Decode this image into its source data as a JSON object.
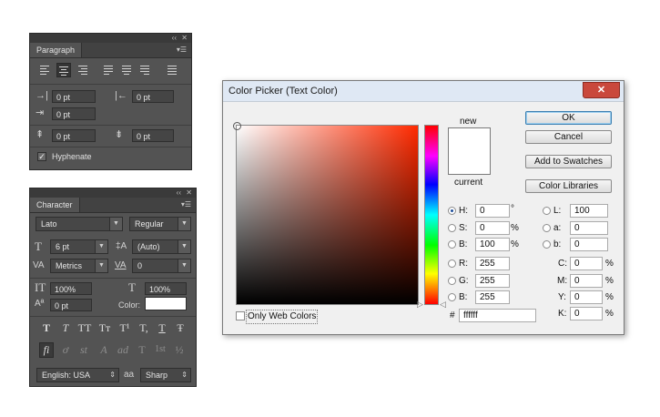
{
  "paragraph_panel": {
    "tab": "Paragraph",
    "collapse": "‹‹",
    "close": "✕",
    "menu": "▾☰",
    "indent_left": "0 pt",
    "indent_right": "0 pt",
    "indent_first_line": "0 pt",
    "space_before": "0 pt",
    "space_after": "0 pt",
    "hyphenate_label": "Hyphenate",
    "hyphenate_checked": true
  },
  "character_panel": {
    "tab": "Character",
    "collapse": "‹‹",
    "close": "✕",
    "menu": "▾☰",
    "font_family": "Lato",
    "font_style": "Regular",
    "font_size": "6 pt",
    "leading": "(Auto)",
    "kerning": "Metrics",
    "tracking": "0",
    "vertical_scale": "100%",
    "horizontal_scale": "100%",
    "baseline_shift": "0 pt",
    "color_label": "Color:",
    "color_value": "#ffffff",
    "language": "English: USA",
    "aa_icon_text": "aa",
    "antialias": "Sharp",
    "style_buttons": [
      "T",
      "T",
      "TT",
      "Tт",
      "T¹",
      "T,",
      "T",
      "Ŧ"
    ],
    "opentype_buttons": [
      "fi",
      "ơ",
      "st",
      "A",
      "ad",
      "T",
      "1st",
      "½"
    ]
  },
  "color_picker": {
    "title": "Color Picker (Text Color)",
    "close": "✕",
    "new_label": "new",
    "current_label": "current",
    "new_color": "#ffffff",
    "current_color": "#ffffff",
    "hue_color": "#ff2a00",
    "buttons": {
      "ok": "OK",
      "cancel": "Cancel",
      "add_to_swatches": "Add to Swatches",
      "color_libraries": "Color Libraries"
    },
    "only_web_colors": "Only Web Colors",
    "only_web_colors_checked": false,
    "hex_label": "#",
    "hex_value": "ffffff",
    "hsb": [
      {
        "label": "H:",
        "value": "0",
        "unit": "°",
        "selected": true
      },
      {
        "label": "S:",
        "value": "0",
        "unit": "%",
        "selected": false
      },
      {
        "label": "B:",
        "value": "100",
        "unit": "%",
        "selected": false
      }
    ],
    "rgb": [
      {
        "label": "R:",
        "value": "255",
        "selected": false
      },
      {
        "label": "G:",
        "value": "255",
        "selected": false
      },
      {
        "label": "B:",
        "value": "255",
        "selected": false
      }
    ],
    "lab": [
      {
        "label": "L:",
        "value": "100",
        "selected": false
      },
      {
        "label": "a:",
        "value": "0",
        "selected": false
      },
      {
        "label": "b:",
        "value": "0",
        "selected": false
      }
    ],
    "cmyk": [
      {
        "label": "C:",
        "value": "0",
        "unit": "%"
      },
      {
        "label": "M:",
        "value": "0",
        "unit": "%"
      },
      {
        "label": "Y:",
        "value": "0",
        "unit": "%"
      },
      {
        "label": "K:",
        "value": "0",
        "unit": "%"
      }
    ]
  }
}
